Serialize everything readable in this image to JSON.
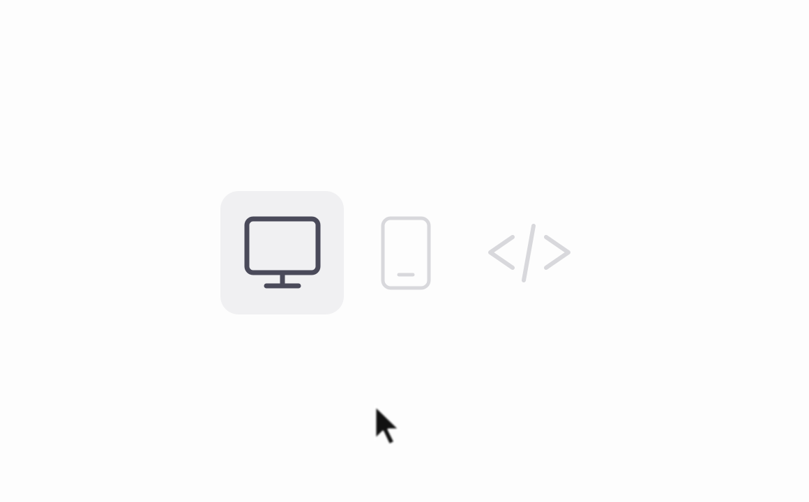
{
  "view_toggle": {
    "selected": "desktop",
    "options": [
      {
        "id": "desktop",
        "icon": "monitor-icon",
        "active": true,
        "color": "#4a4a5a"
      },
      {
        "id": "mobile",
        "icon": "phone-icon",
        "active": false,
        "color": "#d8d8dc"
      },
      {
        "id": "code",
        "icon": "code-icon",
        "active": false,
        "color": "#d8d8dc"
      }
    ]
  },
  "colors": {
    "background": "#fdfdfd",
    "active_bg": "#f0f0f2",
    "active_icon": "#4a4a5a",
    "inactive_icon": "#d8d8dc"
  }
}
